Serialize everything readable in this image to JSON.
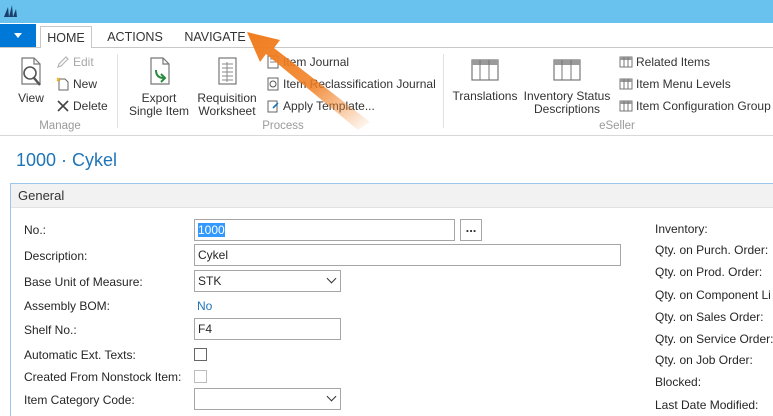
{
  "tabs": [
    {
      "label": "HOME",
      "active": true
    },
    {
      "label": "ACTIONS",
      "active": false
    },
    {
      "label": "NAVIGATE",
      "active": false
    }
  ],
  "ribbon": {
    "manage": {
      "label": "Manage",
      "view": "View",
      "edit": "Edit",
      "new": "New",
      "delete": "Delete"
    },
    "process": {
      "label": "Process",
      "export_line1": "Export",
      "export_line2": "Single Item",
      "requisition_line1": "Requisition",
      "requisition_line2": "Worksheet",
      "item_journal": "Item Journal",
      "item_reclass_journal": "Item Reclassification Journal",
      "apply_template": "Apply Template..."
    },
    "eseller": {
      "label": "eSeller",
      "translations": "Translations",
      "inv_status_line1": "Inventory Status",
      "inv_status_line2": "Descriptions",
      "related_items": "Related Items",
      "item_menu_levels": "Item Menu Levels",
      "item_config_group": "Item Configuration Group"
    }
  },
  "page": {
    "title": "1000 · Cykel",
    "fasttab": "General"
  },
  "form": {
    "no_label": "No.:",
    "no_value": "1000",
    "assist_label": "...",
    "description_label": "Description:",
    "description_value": "Cykel",
    "base_uom_label": "Base Unit of Measure:",
    "base_uom_value": "STK",
    "assembly_bom_label": "Assembly BOM:",
    "assembly_bom_value": "No",
    "shelf_no_label": "Shelf No.:",
    "shelf_no_value": "F4",
    "auto_ext_texts_label": "Automatic Ext. Texts:",
    "auto_ext_texts_checked": false,
    "created_nonstock_label": "Created From Nonstock Item:",
    "created_nonstock_checked": false,
    "item_category_label": "Item Category Code:",
    "item_category_value": ""
  },
  "right_fields": {
    "inventory": "Inventory:",
    "qty_purch": "Qty. on Purch. Order:",
    "qty_prod": "Qty. on Prod. Order:",
    "qty_component": "Qty. on Component Li",
    "qty_sales": "Qty. on Sales Order:",
    "qty_service": "Qty. on Service Order:",
    "qty_job": "Qty. on Job Order:",
    "blocked": "Blocked:",
    "last_modified": "Last Date Modified:"
  },
  "colors": {
    "titlebar": "#69c1ed",
    "accent": "#0078d7",
    "title_text": "#1f75b8",
    "arrow": "#f07d1f"
  }
}
